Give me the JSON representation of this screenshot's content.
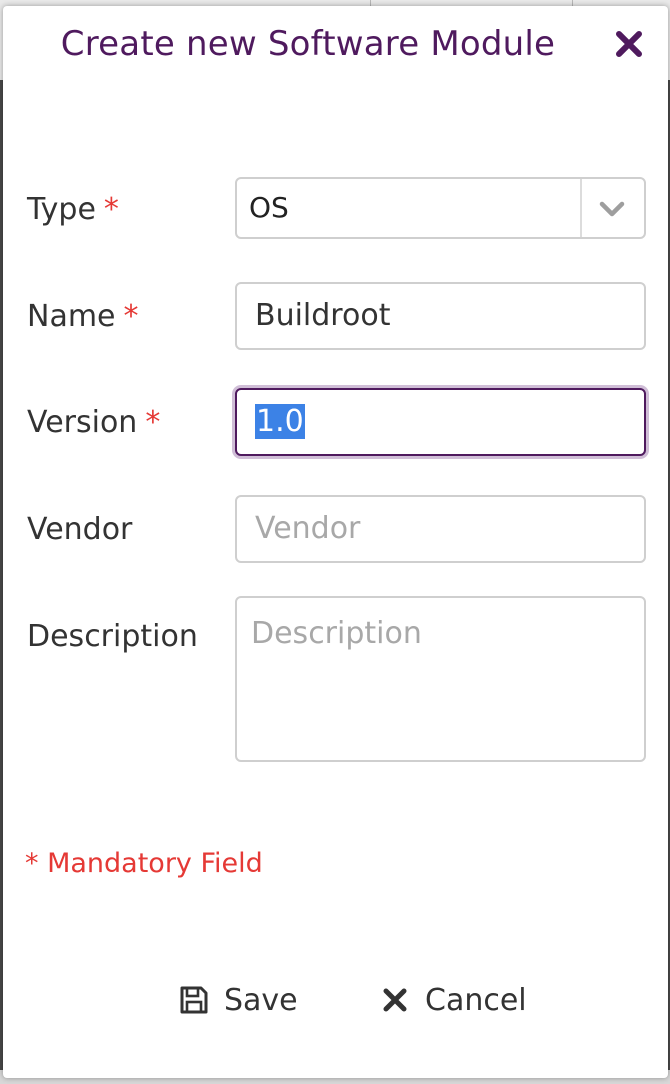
{
  "dialog": {
    "title": "Create new Software Module",
    "close_icon": "close-x-icon"
  },
  "form": {
    "type": {
      "label": "Type",
      "required_marker": "*",
      "value": "OS",
      "icon": "chevron-down-icon"
    },
    "name": {
      "label": "Name",
      "required_marker": "*",
      "value": "Buildroot"
    },
    "version": {
      "label": "Version",
      "required_marker": "*",
      "value": "1.0"
    },
    "vendor": {
      "label": "Vendor",
      "placeholder": "Vendor"
    },
    "description": {
      "label": "Description",
      "placeholder": "Description"
    }
  },
  "mandatory_note": "* Mandatory Field",
  "footer": {
    "save_label": "Save",
    "save_icon": "floppy-disk-icon",
    "cancel_label": "Cancel",
    "cancel_icon": "close-x-icon"
  },
  "colors": {
    "title": "#4f1a5e",
    "required": "#e53935",
    "focus_border": "#4f1a5e",
    "selection": "#3c82e6"
  }
}
